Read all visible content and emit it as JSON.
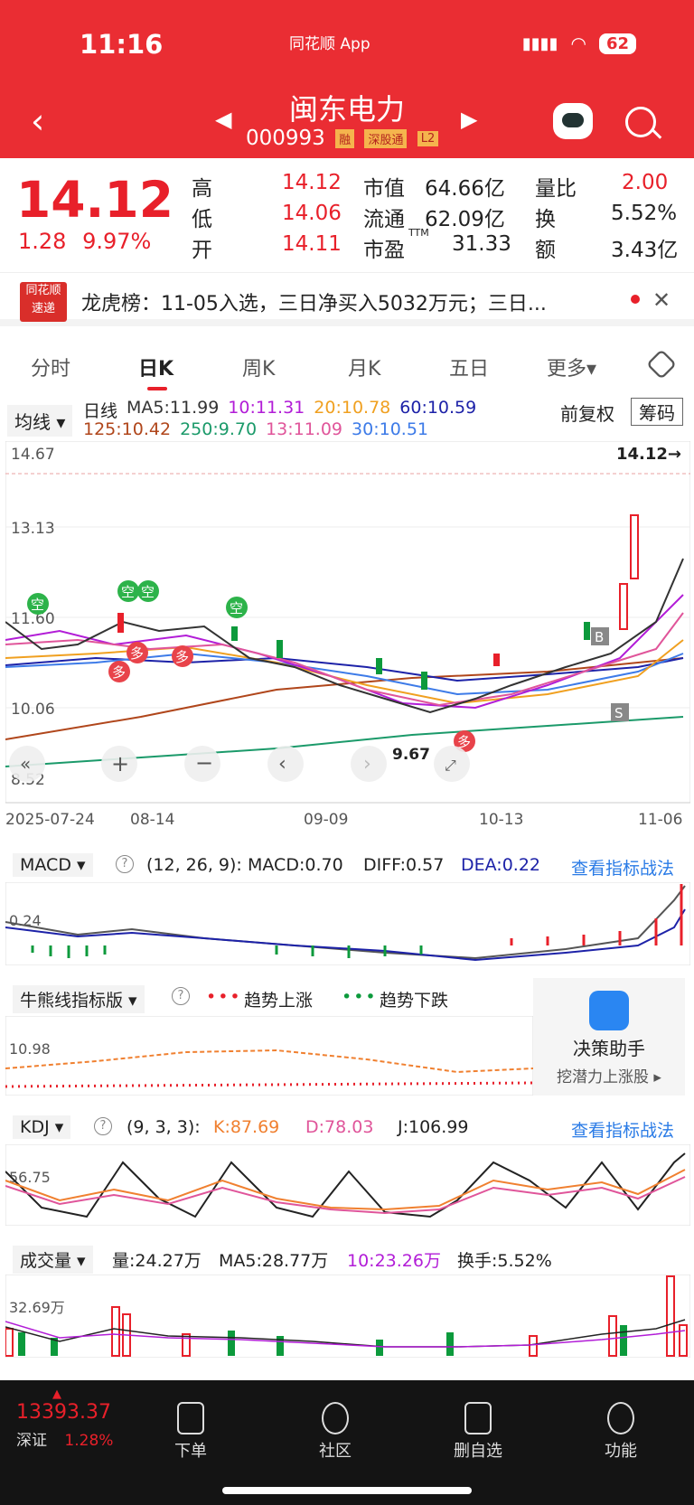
{
  "status_bar": {
    "time": "11:16",
    "app_label": "同花顺 App",
    "battery": "62"
  },
  "header": {
    "stock_name": "闽东电力",
    "stock_code": "000993",
    "tags": [
      "融",
      "深股通",
      "L2"
    ]
  },
  "quote": {
    "price": "14.12",
    "change": "1.28",
    "change_pct": "9.97%",
    "high_label": "高",
    "high": "14.12",
    "low_label": "低",
    "low": "14.06",
    "open_label": "开",
    "open": "14.11",
    "mktcap_label": "市值",
    "mktcap": "64.66亿",
    "float_label": "流通",
    "float": "62.09亿",
    "pe_label": "市盈",
    "pe_sup": "TTM",
    "pe": "31.33",
    "volratio_label": "量比",
    "volratio": "2.00",
    "turnover_label": "换",
    "turnover": "5.52%",
    "amount_label": "额",
    "amount": "3.43亿"
  },
  "news": {
    "logo_line1": "同花顺",
    "logo_line2": "速递",
    "text": "龙虎榜：11-05入选，三日净买入5032万元；三日..."
  },
  "tabs": [
    "分时",
    "日K",
    "周K",
    "月K",
    "五日",
    "更多"
  ],
  "ma_legend": {
    "select": "均线",
    "period": "日线",
    "ma5": "MA5:11.99",
    "ma10": "10:11.31",
    "ma20": "20:10.78",
    "ma60": "60:10.59",
    "ma125": "125:10.42",
    "ma250": "250:9.70",
    "ma13": "13:11.09",
    "ma30": "30:10.51",
    "adjust": "前复权",
    "chips": "筹码"
  },
  "kline": {
    "y_labels": [
      "14.67",
      "13.13",
      "11.60",
      "10.06",
      "8.52"
    ],
    "last_price_marker": "14.12→",
    "min_marker": "9.67",
    "dates": [
      "2025-07-24",
      "08-14",
      "09-09",
      "10-13",
      "11-06"
    ],
    "signals_empty": [
      "空",
      "空",
      "空",
      "空"
    ],
    "signals_long": [
      "多",
      "多",
      "多",
      "多"
    ],
    "buy_mark": "B",
    "sell_mark": "S"
  },
  "chart_data": {
    "type": "candlestick",
    "title": "",
    "ylim": [
      8.52,
      14.67
    ],
    "y_ticks": [
      14.67,
      13.13,
      11.6,
      10.06,
      8.52
    ],
    "x_ticks": [
      "2025-07-24",
      "08-14",
      "09-09",
      "10-13",
      "11-06"
    ],
    "last_close": 14.12,
    "period_low": 9.67,
    "series_ma": [
      {
        "name": "MA5",
        "color": "#222222",
        "last": 11.99
      },
      {
        "name": "10",
        "color": "#b21dd7",
        "last": 11.31
      },
      {
        "name": "20",
        "color": "#f0a020",
        "last": 10.78
      },
      {
        "name": "60",
        "color": "#1d22a8",
        "last": 10.59
      },
      {
        "name": "125",
        "color": "#b0461b",
        "last": 10.42
      },
      {
        "name": "250",
        "color": "#1b9a6a",
        "last": 9.7
      },
      {
        "name": "13",
        "color": "#e0559a",
        "last": 11.09
      },
      {
        "name": "30",
        "color": "#3d7be8",
        "last": 10.51
      }
    ]
  },
  "macd": {
    "select": "MACD",
    "params": "(12, 26, 9):",
    "macd": "MACD:0.70",
    "diff": "DIFF:0.57",
    "dea": "DEA:0.22",
    "link": "查看指标战法",
    "y_label": "0.24"
  },
  "bull_bear": {
    "select": "牛熊线指标版",
    "up": "趋势上涨",
    "down": "趋势下跌",
    "y_label": "10.98"
  },
  "decision": {
    "title": "决策助手",
    "subtitle": "挖潜力上涨股 ▸"
  },
  "kdj": {
    "select": "KDJ",
    "params": "(9, 3, 3):",
    "k": "K:87.69",
    "d": "D:78.03",
    "j": "J:106.99",
    "link": "查看指标战法",
    "y_label": "56.75"
  },
  "volume": {
    "select": "成交量",
    "vol": "量:24.27万",
    "ma5": "MA5:28.77万",
    "ma10": "10:23.26万",
    "turnover": "换手:5.52%",
    "y_label": "32.69万"
  },
  "bottom_bar": {
    "index_value": "13393.37",
    "index_name": "深证",
    "index_change": "1.28%",
    "items": [
      "下单",
      "社区",
      "删自选",
      "功能"
    ]
  }
}
